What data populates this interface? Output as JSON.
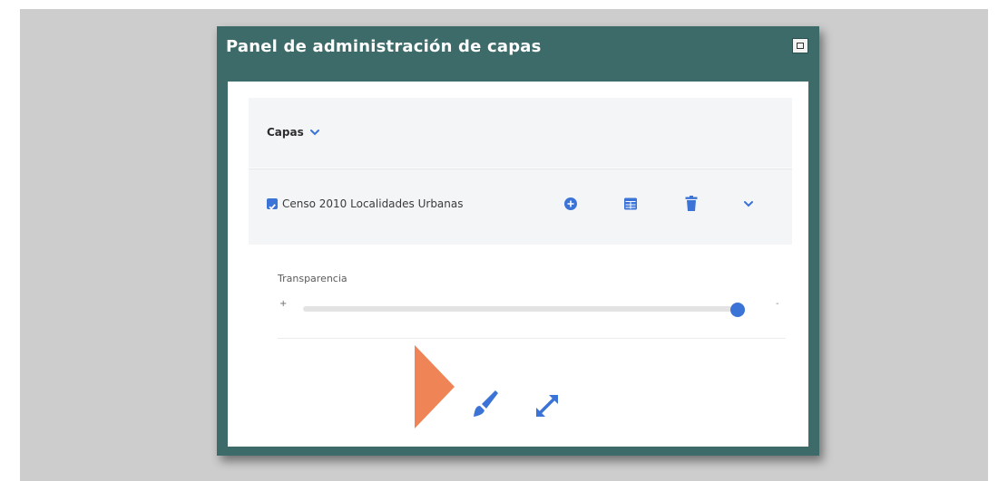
{
  "panel": {
    "title": "Panel de administración de capas",
    "restore_icon": "window-restore-icon"
  },
  "capas": {
    "label": "Capas",
    "toggle_icon": "chevron-down-icon"
  },
  "layer": {
    "checked": true,
    "name": "Censo 2010 Localidades Urbanas",
    "actions": [
      "add-circle-icon",
      "table-icon",
      "trash-icon",
      "chevron-down-icon"
    ]
  },
  "transparency": {
    "label": "Transparencia",
    "plus_label": "+",
    "minus_label": "-",
    "value": 1.0
  },
  "tools": [
    "paintbrush-icon",
    "expand-arrows-icon"
  ],
  "annotation": {
    "pointer_icon": "triangle-pointer",
    "pointer_color": "#ef8457"
  },
  "colors": {
    "panel_frame": "#3d6b69",
    "accent": "#3b73d6",
    "section_bg": "#f4f5f6",
    "backdrop": "#cdcdcd"
  }
}
